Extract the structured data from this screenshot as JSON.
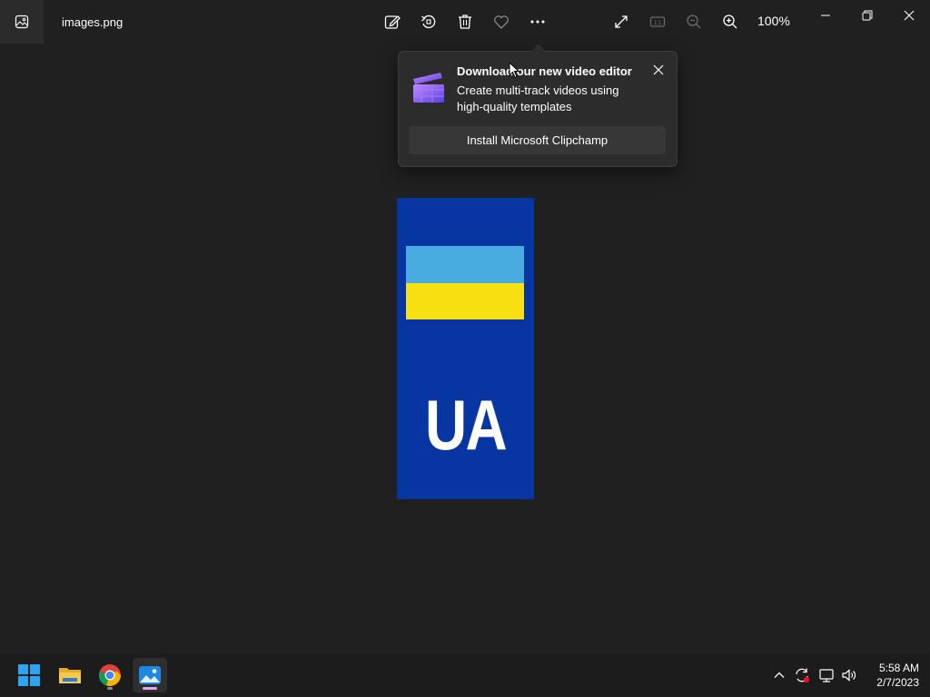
{
  "titlebar": {
    "file_name": "images.png",
    "zoom": "100%",
    "toolbar_icons": [
      "edit-image-icon",
      "rotate-icon",
      "delete-icon",
      "favorite-icon",
      "more-icon"
    ],
    "view_icons": [
      "full-screen-icon",
      "actual-size-icon",
      "zoom-out-icon",
      "zoom-in-icon"
    ],
    "window_controls": [
      "minimize-icon",
      "restore-icon",
      "close-icon"
    ]
  },
  "popup": {
    "title": "Download our new video editor",
    "description": "Create multi-track videos using high-quality templates",
    "button_label": "Install Microsoft Clipchamp"
  },
  "image": {
    "code": "UA",
    "colors": {
      "background": "#0736a3",
      "flag_top": "#48ace0",
      "flag_bottom": "#f7df12"
    }
  },
  "taskbar": {
    "apps": [
      "windows-start-icon",
      "file-explorer-icon",
      "chrome-icon",
      "photos-icon"
    ],
    "tray": [
      "chevron-up-icon",
      "sync-icon",
      "network-icon",
      "volume-icon"
    ],
    "time": "5:58 AM",
    "date": "2/7/2023"
  }
}
